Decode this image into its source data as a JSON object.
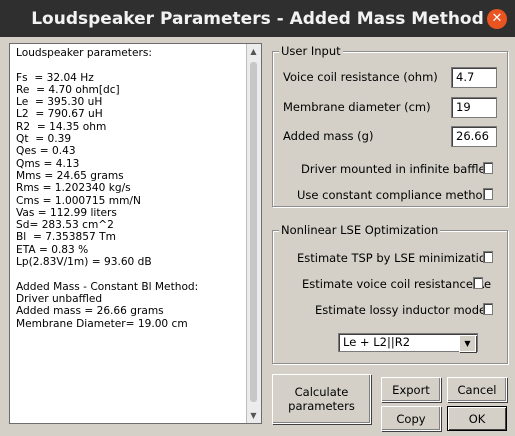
{
  "window": {
    "title": "Loudspeaker Parameters - Added Mass Method",
    "close_glyph": "✕"
  },
  "output": {
    "lines": [
      "Loudspeaker parameters:",
      "",
      "Fs  = 32.04 Hz",
      "Re  = 4.70 ohm[dc]",
      "Le  = 395.30 uH",
      "L2  = 790.67 uH",
      "R2  = 14.35 ohm",
      "Qt  = 0.39",
      "Qes = 0.43",
      "Qms = 4.13",
      "Mms = 24.65 grams",
      "Rms = 1.202340 kg/s",
      "Cms = 1.000715 mm/N",
      "Vas = 112.99 liters",
      "Sd= 283.53 cm^2",
      "Bl  = 7.353857 Tm",
      "ETA = 0.83 %",
      "Lp(2.83V/1m) = 93.60 dB",
      "",
      "Added Mass - Constant Bl Method:",
      "Driver unbaffled",
      "Added mass = 26.66 grams",
      "Membrane Diameter= 19.00 cm"
    ]
  },
  "user_input": {
    "legend": "User Input",
    "voice_coil_label": "Voice coil resistance (ohm)",
    "voice_coil_value": "4.7",
    "diameter_label": "Membrane diameter (cm)",
    "diameter_value": "19",
    "added_mass_label": "Added mass (g)",
    "added_mass_value": "26.66",
    "infinite_baffle_label": "Driver mounted in infinite baffle",
    "infinite_baffle_checked": false,
    "constant_compliance_label": "Use constant compliance method",
    "constant_compliance_checked": false
  },
  "lse": {
    "legend": "Nonlinear LSE Optimization",
    "tsp_label": "Estimate TSP by LSE minimization",
    "tsp_checked": false,
    "re_label": "Estimate voice coil resistance Re",
    "re_checked": false,
    "inductor_label": "Estimate lossy inductor model",
    "inductor_checked": false,
    "model_selected": "Le + L2||R2",
    "dropdown_glyph": "▼"
  },
  "buttons": {
    "calculate": "Calculate\nparameters",
    "export": "Export",
    "cancel": "Cancel",
    "copy": "Copy",
    "ok": "OK"
  },
  "scrollbar": {
    "up_glyph": "▲",
    "down_glyph": "▼"
  },
  "colors": {
    "titlebar": "#2f2f2f",
    "close_button": "#e95420",
    "dialog_background": "#d4d0c8"
  }
}
